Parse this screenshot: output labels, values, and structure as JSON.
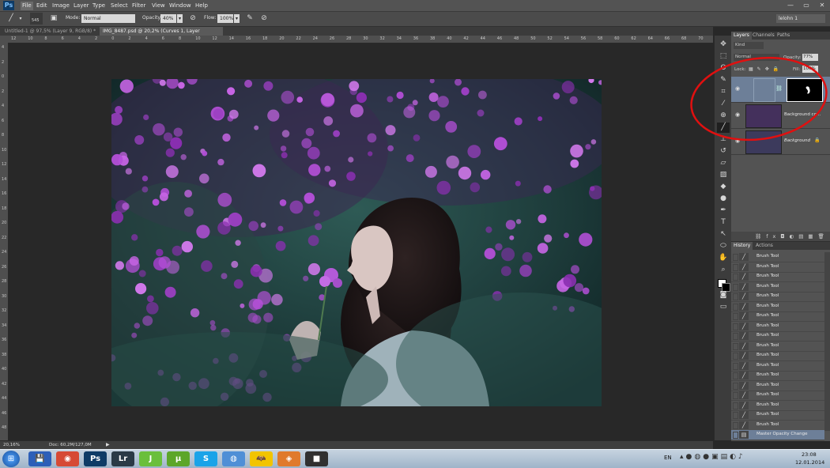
{
  "app": {
    "logo": "Ps"
  },
  "menu": [
    "File",
    "Edit",
    "Image",
    "Layer",
    "Type",
    "Select",
    "Filter",
    "View",
    "Window",
    "Help"
  ],
  "window_controls": {
    "minimize": "—",
    "maximize": "▭",
    "close": "✕"
  },
  "options": {
    "brush_size": "545",
    "mode_label": "Mode:",
    "mode_value": "Normal",
    "opacity_label": "Opacity:",
    "opacity_value": "40%",
    "flow_label": "Flow:",
    "flow_value": "100%",
    "workspace": "lelohn 1"
  },
  "tabs": [
    {
      "label": "Untitled-1 @ 97,5% (Layer 9, RGB/8) *"
    },
    {
      "label": "IMG_8487.psd @ 20,2% (Curves 1, Layer Mask/8) *"
    }
  ],
  "ruler_h": [
    "12",
    "10",
    "8",
    "6",
    "4",
    "2",
    "0",
    "2",
    "4",
    "6",
    "8",
    "10",
    "12",
    "14",
    "16",
    "18",
    "20",
    "22",
    "24",
    "26",
    "28",
    "30",
    "32",
    "34",
    "36",
    "38",
    "40",
    "42",
    "44",
    "46",
    "48",
    "50",
    "52",
    "54",
    "56",
    "58",
    "60",
    "62",
    "64",
    "66",
    "68",
    "70"
  ],
  "ruler_v": [
    "4",
    "2",
    "0",
    "2",
    "4",
    "6",
    "8",
    "10",
    "12",
    "14",
    "16",
    "18",
    "20",
    "22",
    "24",
    "26",
    "28",
    "30",
    "32",
    "34",
    "36",
    "38",
    "40",
    "42",
    "44",
    "46",
    "48",
    "50"
  ],
  "status": {
    "zoom": "20,16%",
    "doc": "Doc: 60,2M/127,0M"
  },
  "layers_panel": {
    "tabs": [
      "Layers",
      "Channels",
      "Paths"
    ],
    "kind": "Kind",
    "blend": "Normal",
    "opacity_label": "Opacity:",
    "opacity_value": "77%",
    "lock_label": "Lock:",
    "fill_label": "Fill:",
    "fill_value": "100%",
    "layers": [
      {
        "name": ""
      },
      {
        "name": "Background co..."
      },
      {
        "name": "Background"
      }
    ],
    "footer_icons": [
      "⛓",
      "fx",
      "◘",
      "◐",
      "▤",
      "▦",
      "🗑"
    ]
  },
  "history_panel": {
    "tabs": [
      "History",
      "Actions"
    ],
    "items": [
      "Brush Tool",
      "Brush Tool",
      "Brush Tool",
      "Brush Tool",
      "Brush Tool",
      "Brush Tool",
      "Brush Tool",
      "Brush Tool",
      "Brush Tool",
      "Brush Tool",
      "Brush Tool",
      "Brush Tool",
      "Brush Tool",
      "Brush Tool",
      "Brush Tool",
      "Brush Tool",
      "Brush Tool",
      "Brush Tool",
      "Master Opacity Change"
    ]
  },
  "taskbar": {
    "lang": "EN",
    "time": "23:08",
    "date": "12.01.2014",
    "apps": [
      {
        "icon": "floppy-icon",
        "label": "💾",
        "bg": "#2d5fb8"
      },
      {
        "icon": "chrome-icon",
        "label": "◉",
        "bg": "#d64a35"
      },
      {
        "icon": "photoshop-icon",
        "label": "Ps",
        "bg": "#0e3b66"
      },
      {
        "icon": "lightroom-icon",
        "label": "Lr",
        "bg": "#2b3a46"
      },
      {
        "icon": "j-app-icon",
        "label": "J",
        "bg": "#6abf3b"
      },
      {
        "icon": "utorrent-icon",
        "label": "µ",
        "bg": "#5ca629"
      },
      {
        "icon": "skype-icon",
        "label": "S",
        "bg": "#1aa3e8"
      },
      {
        "icon": "globe-icon",
        "label": "◍",
        "bg": "#4f8fd6"
      },
      {
        "icon": "batman-icon",
        "label": "🦇",
        "bg": "#f2c400"
      },
      {
        "icon": "eye-app-icon",
        "label": "◈",
        "bg": "#e07a2c"
      },
      {
        "icon": "camera-icon",
        "label": "■",
        "bg": "#303030"
      }
    ]
  }
}
